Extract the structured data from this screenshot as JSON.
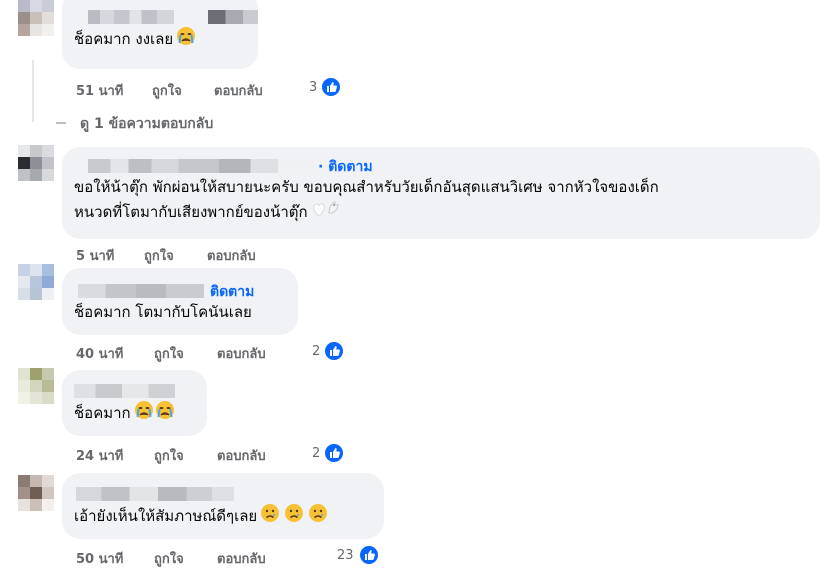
{
  "comments": [
    {
      "text": "ช็อคมาก งงเลย",
      "emoji": "crying-face",
      "time": "51 นาที",
      "like_label": "ถูกใจ",
      "reply_label": "ตอบกลับ",
      "reaction_count": "3"
    },
    {
      "follow_label": "· ติดตาม",
      "text_line1": "ขอให้น้าตุ๊ก พักผ่อนให้สบายนะครับ ขอบคุณสำหรับวัยเด็กอันสุดแสนวิเศษ จากหัวใจของเด็ก",
      "text_line2": "หนวดที่โตมากับเสียงพากย์ของน้าตุ๊ก",
      "emoji": "white-heart-dove",
      "time": "5 นาที",
      "like_label": "ถูกใจ",
      "reply_label": "ตอบกลับ"
    },
    {
      "follow_label": "ติดตาม",
      "text": "ช็อคมาก โตมากับโคนันเลย",
      "time": "40 นาที",
      "like_label": "ถูกใจ",
      "reply_label": "ตอบกลับ",
      "reaction_count": "2"
    },
    {
      "text": "ช็อคมาก",
      "emoji": "crying-face-x2",
      "time": "24 นาที",
      "like_label": "ถูกใจ",
      "reply_label": "ตอบกลับ",
      "reaction_count": "2"
    },
    {
      "text": "เอ้ายังเห็นให้สัมภาษณ์ดีๆเลย",
      "emoji": "sad-face-x3",
      "time": "50 นาที",
      "like_label": "ถูกใจ",
      "reply_label": "ตอบกลับ",
      "reaction_count": "23"
    }
  ],
  "view_replies": "ดู 1 ข้อความตอบกลับ",
  "colors": {
    "bubble": "#f0f2f5",
    "link_blue": "#0866ff",
    "meta_gray": "#65676b",
    "text": "#050505"
  }
}
